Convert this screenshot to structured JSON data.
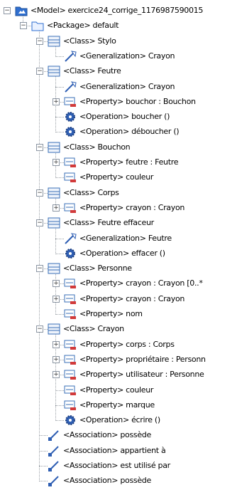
{
  "tree": {
    "nodes": [
      {
        "label": "<Model> exercice24_corrige_1176987590015",
        "icon": "model-icon",
        "depth": 0,
        "expanded": true,
        "kids": true
      },
      {
        "label": "<Package> default",
        "icon": "package-icon",
        "depth": 1,
        "expanded": true,
        "kids": true
      },
      {
        "label": "<Class> Stylo",
        "icon": "class-icon",
        "depth": 2,
        "expanded": true,
        "kids": true
      },
      {
        "label": "<Generalization> Crayon",
        "icon": "generalization-icon",
        "depth": 3,
        "kids": false
      },
      {
        "label": "<Class> Feutre",
        "icon": "class-icon",
        "depth": 2,
        "expanded": true,
        "kids": true
      },
      {
        "label": "<Generalization> Crayon",
        "icon": "generalization-icon",
        "depth": 3,
        "kids": false
      },
      {
        "label": "<Property> bouchor : Bouchon",
        "icon": "property-icon",
        "depth": 3,
        "expanded": false,
        "kids": true
      },
      {
        "label": "<Operation> boucher ()",
        "icon": "operation-icon",
        "depth": 3,
        "kids": false
      },
      {
        "label": "<Operation> déboucher ()",
        "icon": "operation-icon",
        "depth": 3,
        "kids": false
      },
      {
        "label": "<Class> Bouchon",
        "icon": "class-icon",
        "depth": 2,
        "expanded": true,
        "kids": true
      },
      {
        "label": "<Property> feutre : Feutre",
        "icon": "property-icon",
        "depth": 3,
        "expanded": false,
        "kids": true
      },
      {
        "label": "<Property> couleur",
        "icon": "property-icon",
        "depth": 3,
        "kids": false
      },
      {
        "label": "<Class> Corps",
        "icon": "class-icon",
        "depth": 2,
        "expanded": true,
        "kids": true
      },
      {
        "label": "<Property> crayon : Crayon",
        "icon": "property-icon",
        "depth": 3,
        "expanded": false,
        "kids": true
      },
      {
        "label": "<Class> Feutre effaceur",
        "icon": "class-icon",
        "depth": 2,
        "expanded": true,
        "kids": true
      },
      {
        "label": "<Generalization> Feutre",
        "icon": "generalization-icon",
        "depth": 3,
        "kids": false
      },
      {
        "label": "<Operation> effacer ()",
        "icon": "operation-icon",
        "depth": 3,
        "kids": false
      },
      {
        "label": "<Class> Personne",
        "icon": "class-icon",
        "depth": 2,
        "expanded": true,
        "kids": true
      },
      {
        "label": "<Property> crayon : Crayon [0..*",
        "icon": "property-icon",
        "depth": 3,
        "expanded": false,
        "kids": true
      },
      {
        "label": "<Property> crayon : Crayon",
        "icon": "property-icon",
        "depth": 3,
        "expanded": false,
        "kids": true
      },
      {
        "label": "<Property> nom",
        "icon": "property-icon",
        "depth": 3,
        "kids": false
      },
      {
        "label": "<Class> Crayon",
        "icon": "class-icon",
        "depth": 2,
        "expanded": true,
        "kids": true
      },
      {
        "label": "<Property> corps : Corps",
        "icon": "property-icon",
        "depth": 3,
        "expanded": false,
        "kids": true
      },
      {
        "label": "<Property> propriétaire : Personn",
        "icon": "property-icon",
        "depth": 3,
        "expanded": false,
        "kids": true
      },
      {
        "label": "<Property> utilisateur : Personne",
        "icon": "property-icon",
        "depth": 3,
        "expanded": false,
        "kids": true
      },
      {
        "label": "<Property> couleur",
        "icon": "property-icon",
        "depth": 3,
        "kids": false
      },
      {
        "label": "<Property> marque",
        "icon": "property-icon",
        "depth": 3,
        "kids": false
      },
      {
        "label": "<Operation> écrire ()",
        "icon": "operation-icon",
        "depth": 3,
        "kids": false
      },
      {
        "label": "<Association> possède",
        "icon": "association-icon",
        "depth": 2,
        "kids": false
      },
      {
        "label": "<Association> appartient à",
        "icon": "association-icon",
        "depth": 2,
        "kids": false
      },
      {
        "label": "<Association> est utilisé par",
        "icon": "association-icon",
        "depth": 2,
        "kids": false
      },
      {
        "label": "<Association> possède",
        "icon": "association-icon",
        "depth": 2,
        "kids": false
      }
    ]
  },
  "colors": {
    "classBlue": "#3a6fb7",
    "classFill": "#eef3fb",
    "propRed": "#d23a3a",
    "opBlue": "#2f5fb3",
    "packageBlue": "#2f6fd0",
    "connector": "#9aa0a6"
  }
}
